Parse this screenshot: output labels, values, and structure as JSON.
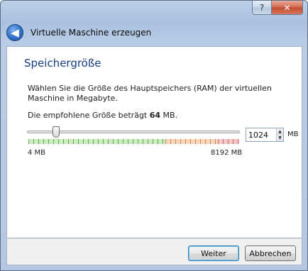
{
  "window": {
    "title": "Virtuelle Maschine erzeugen",
    "help_label": "?",
    "close_label": "✕",
    "back_label": "◀"
  },
  "page": {
    "heading": "Speichergröße",
    "description": "Wählen Sie die Größe des Hauptspeichers (RAM) der virtuellen Maschine in Megabyte.",
    "recommend_prefix": "Die empfohlene Größe beträgt ",
    "recommend_value": "64",
    "recommend_suffix": " MB."
  },
  "memory": {
    "value": "1024",
    "unit": "MB",
    "min_label": "4 MB",
    "max_label": "8192 MB",
    "min_mb": 4,
    "max_mb": 8192,
    "current_mb": 1024,
    "zones": [
      {
        "name": "green",
        "fraction": 0.65
      },
      {
        "name": "orange",
        "fraction": 0.25
      },
      {
        "name": "red",
        "fraction": 0.1
      }
    ]
  },
  "buttons": {
    "next": "Weiter",
    "cancel": "Abbrechen"
  },
  "colors": {
    "heading": "#163c84",
    "accent": "#2f6fc8"
  }
}
